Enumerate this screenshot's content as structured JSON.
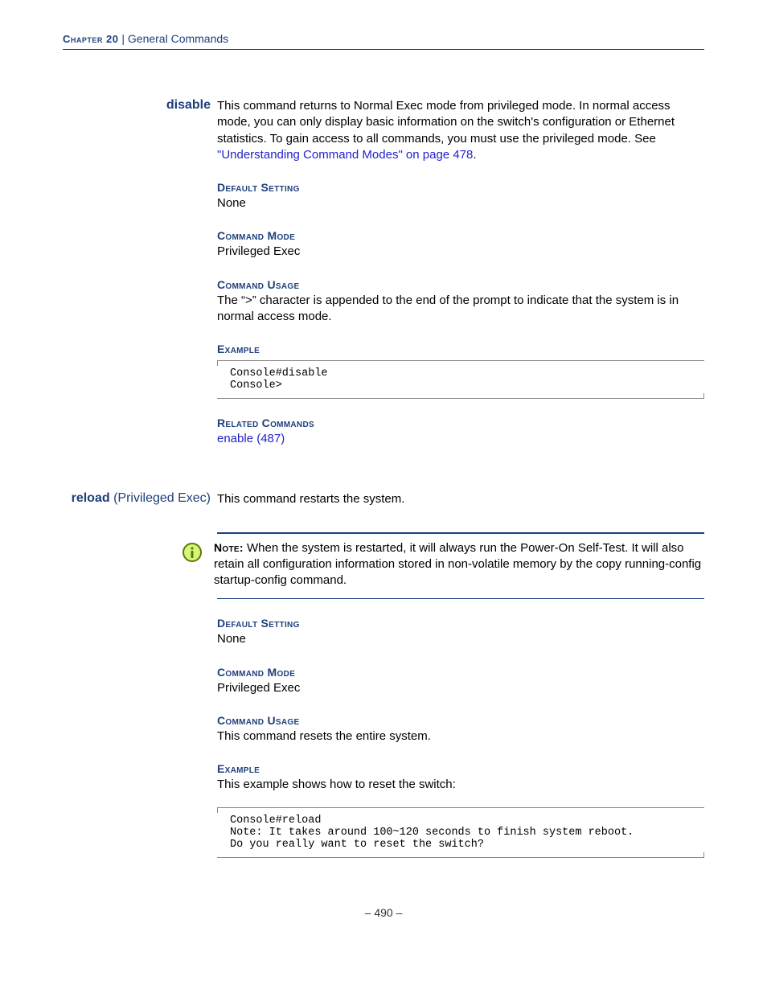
{
  "header": {
    "chapter_label": "Chapter 20",
    "separator": "  |  ",
    "chapter_title": "General Commands"
  },
  "disable": {
    "name": "disable",
    "intro_1": "This command returns to Normal Exec mode from privileged mode. In normal access mode, you can only display basic information on the switch's configuration or Ethernet statistics. To gain access to all commands, you must use the privileged mode. See ",
    "intro_link": "\"Understanding Command Modes\" on page 478",
    "intro_2": ".",
    "default_heading": "Default Setting",
    "default_value": "None",
    "mode_heading": "Command Mode",
    "mode_value": "Privileged Exec",
    "usage_heading": "Command Usage",
    "usage_value": "The “>” character is appended to the end of the prompt to indicate that the system is in normal access mode.",
    "example_heading": "Example",
    "example_code": "Console#disable\nConsole>",
    "related_heading": "Related Commands",
    "related_link": "enable (487)"
  },
  "reload": {
    "name": "reload",
    "name_extra": " (Privileged Exec)",
    "intro": "This command restarts the system.",
    "note_label": "Note:",
    "note_text": " When the system is restarted, it will always run the Power-On Self-Test. It will also retain all configuration information stored in non-volatile memory by the copy running-config startup-config command.",
    "default_heading": "Default Setting",
    "default_value": "None",
    "mode_heading": "Command Mode",
    "mode_value": "Privileged Exec",
    "usage_heading": "Command Usage",
    "usage_value": "This command resets the entire system.",
    "example_heading": "Example",
    "example_intro": "This example shows how to reset the switch:",
    "example_code": "Console#reload\nNote: It takes around 100~120 seconds to finish system reboot.\nDo you really want to reset the switch?"
  },
  "footer": "–  490  –"
}
